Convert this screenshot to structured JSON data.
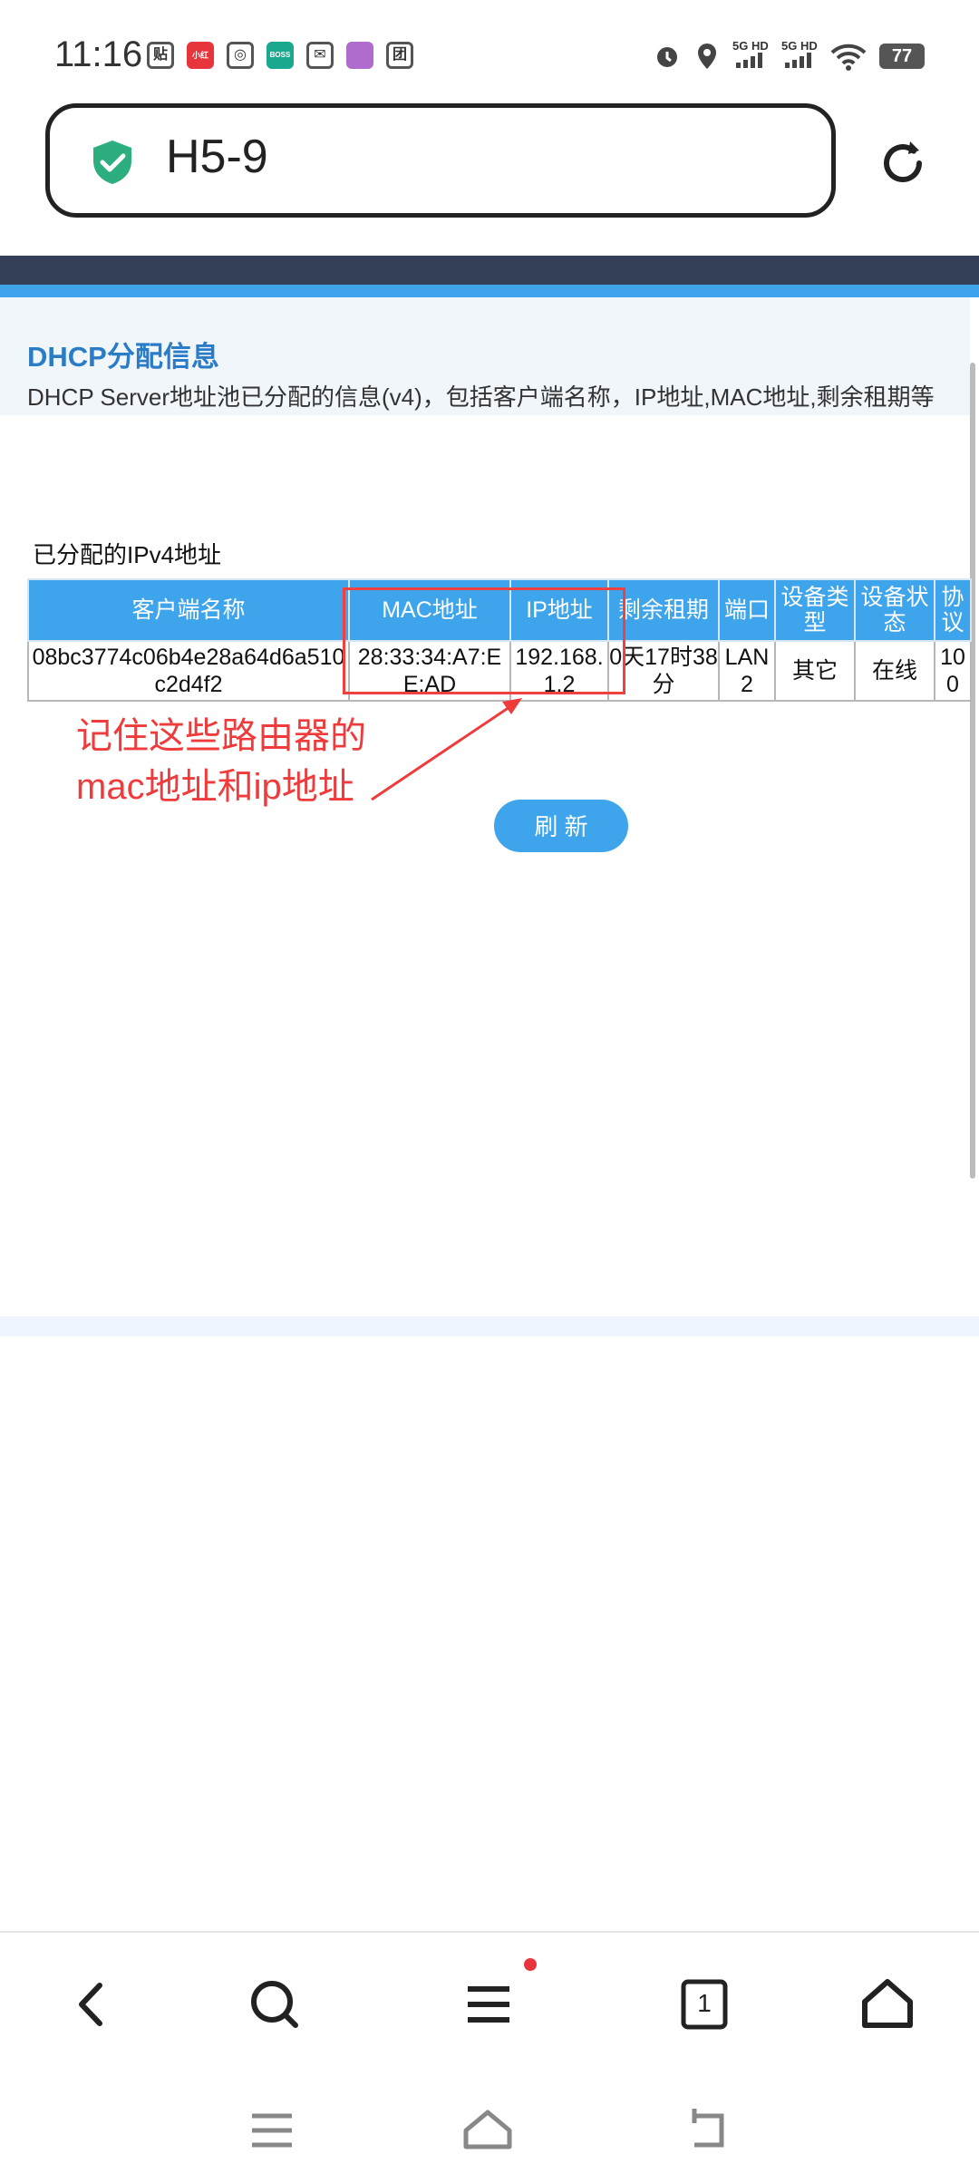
{
  "status_bar": {
    "time": "11:16",
    "app_icons": [
      "贴",
      "小红书",
      "",
      "BOSS直聘",
      "",
      "",
      "团"
    ],
    "signal_1": "5G HD",
    "signal_2": "5G HD",
    "battery": "77"
  },
  "browser": {
    "url_text": "H5-9"
  },
  "page": {
    "title": "DHCP分配信息",
    "description": "DHCP Server地址池已分配的信息(v4)，包括客户端名称，IP地址,MAC地址,剩余租期等",
    "section_label": "已分配的IPv4地址",
    "table": {
      "headers": [
        "客户端名称",
        "MAC地址",
        "IP地址",
        "剩余租期",
        "端口",
        "设备类型",
        "设备状态",
        "协议"
      ],
      "rows": [
        [
          "08bc3774c06b4e28a64d6a510c2d4f2",
          "28:33:34:A7:EE:AD",
          "192.168.1.2",
          "0天17时38分",
          "LAN2",
          "其它",
          "在线",
          "100"
        ]
      ]
    },
    "annotation": "记住这些路由器的mac地址和ip地址",
    "refresh_label": "刷 新"
  },
  "bottom_bar": {
    "tabs_count": "1"
  },
  "colors": {
    "accent": "#3ea4ec",
    "title": "#2b7cc7",
    "annotation": "#ef3b3b",
    "header_dark": "#344057"
  }
}
